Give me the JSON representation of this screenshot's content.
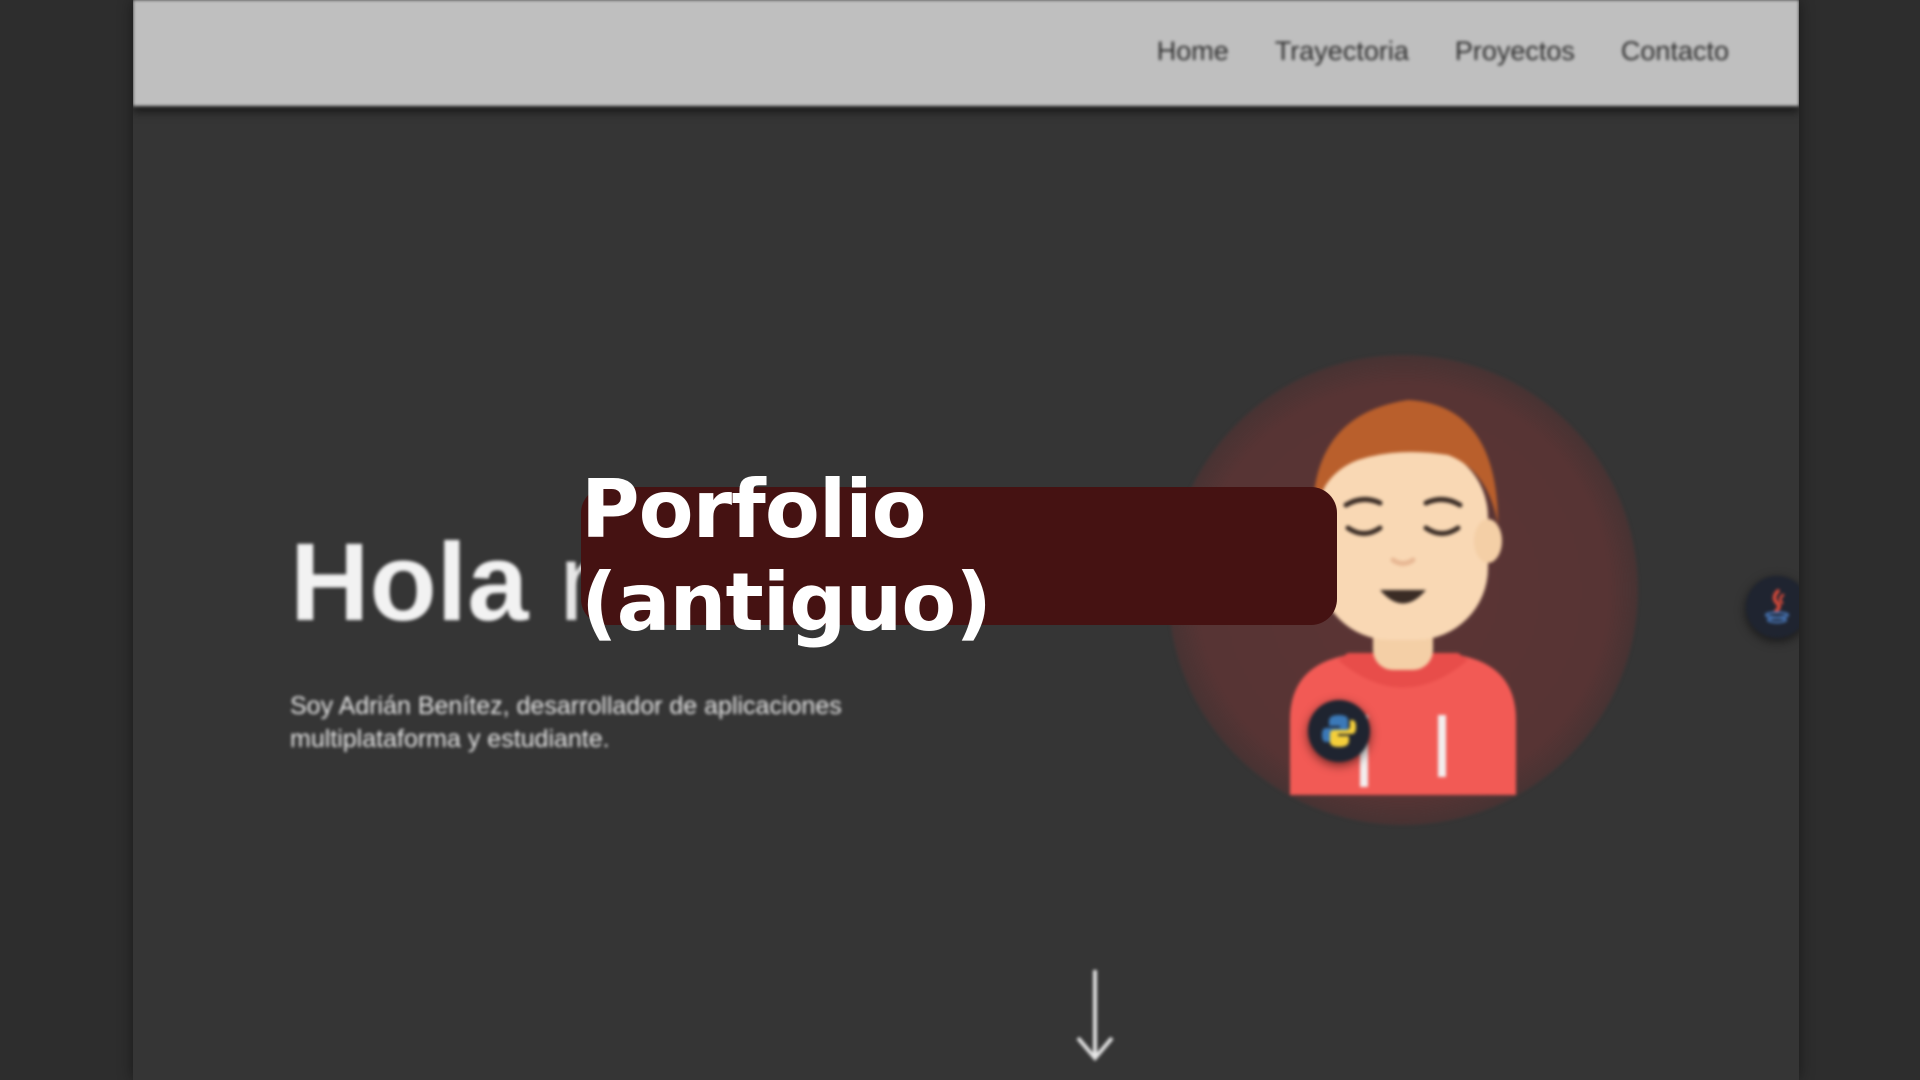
{
  "nav": {
    "items": [
      {
        "label": "Home"
      },
      {
        "label": "Trayectoria"
      },
      {
        "label": "Proyectos"
      },
      {
        "label": "Contacto"
      }
    ]
  },
  "hero": {
    "title_bold": "Hola",
    "title_light": "mundo",
    "subtitle_line1": "Soy Adrián Benítez,  desarrollador de aplicaciones",
    "subtitle_line2": "multiplataforma y estudiante."
  },
  "badges": {
    "left": "python-icon",
    "right": "java-icon"
  },
  "overlay": {
    "label": "Porfolio (antiguo)"
  },
  "colors": {
    "navbar": "#bfbfbf",
    "page_bg": "#353535",
    "overlay_bg": "#451212",
    "hoodie": "#f25a55",
    "hair": "#b95f2c",
    "skin": "#f9d8b4"
  }
}
